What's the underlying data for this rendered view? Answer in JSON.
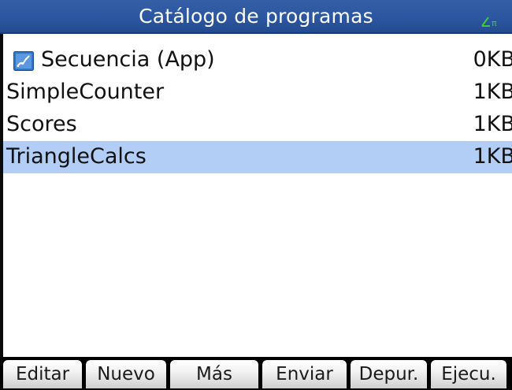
{
  "title_bar": {
    "title": "Catálogo de programas",
    "angle_indicator_icon": "angle-pi-icon",
    "angle_indicator_color": "#3ec93e"
  },
  "programs": [
    {
      "name": "Secuencia (App)",
      "size": "0KB",
      "icon": "sequence-app-icon",
      "selected": false
    },
    {
      "name": "SimpleCounter",
      "size": "1KB",
      "selected": false
    },
    {
      "name": "Scores",
      "size": "1KB",
      "selected": false
    },
    {
      "name": "TriangleCalcs",
      "size": "1KB",
      "selected": true
    }
  ],
  "menu": {
    "edit": "Editar",
    "new": "Nuevo",
    "more": "Más",
    "send": "Enviar",
    "debug": "Depur.",
    "run": "Ejecu."
  },
  "colors": {
    "title_bar": "#2c56a0",
    "selection": "#b2cdf6",
    "menu_background": "#000000",
    "app_icon": "#2f74c9"
  }
}
